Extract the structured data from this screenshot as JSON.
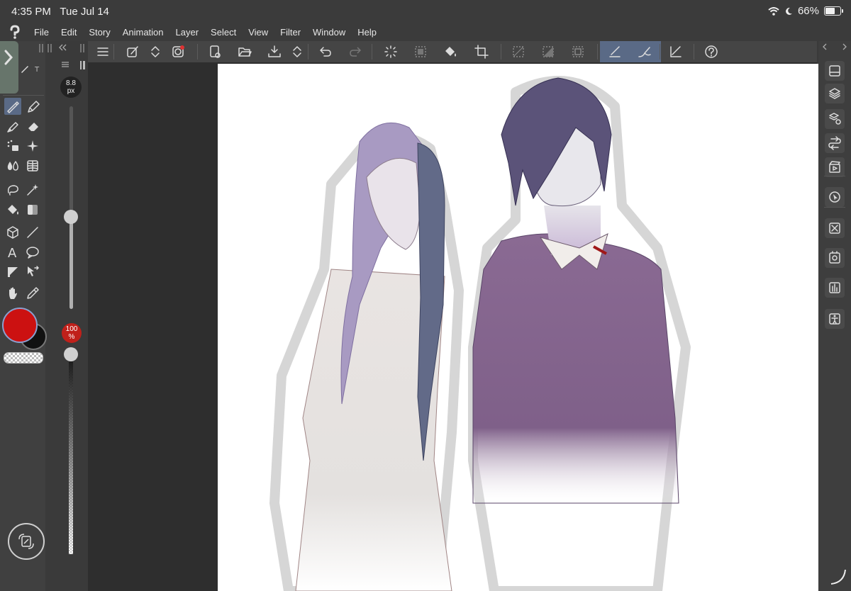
{
  "status": {
    "time": "4:35 PM",
    "date": "Tue Jul 14",
    "battery": "66%"
  },
  "menu": [
    "File",
    "Edit",
    "Story",
    "Animation",
    "Layer",
    "Select",
    "View",
    "Filter",
    "Window",
    "Help"
  ],
  "brush": {
    "size_value": "8.8",
    "size_unit": "px",
    "opacity_value": "100",
    "opacity_unit": "%"
  },
  "colors": {
    "main": "#cc1111",
    "sub": "#111111",
    "accent": "#5a6a86",
    "opacity_badge": "#c0201a"
  },
  "tools": [
    "pen-icon",
    "pencil-icon",
    "marker-icon",
    "eraser-icon",
    "airbrush-icon",
    "decoration-icon",
    "blend-icon",
    "mesh-icon",
    "lasso-icon",
    "magic-wand-icon",
    "fill-icon",
    "gradient-icon",
    "3d-object-icon",
    "line-icon",
    "text-icon",
    "balloon-icon",
    "ruler-icon",
    "operation-icon",
    "hand-icon",
    "eyedropper-icon"
  ],
  "commands": [
    "menu-icon",
    "edit-brush-icon",
    "updown-icon",
    "companion-icon",
    "new-icon",
    "open-icon",
    "save-icon",
    "updown-icon",
    "undo-icon",
    "redo-icon",
    "loading-icon",
    "clear-selection-icon",
    "fill-icon",
    "crop-icon",
    "select-all-icon",
    "invert-icon",
    "border-icon",
    "draw-mode-icon",
    "brush-mode-icon",
    "ruler-mode-icon",
    "help-icon"
  ],
  "right_panels": [
    "window-icon",
    "layers-icon",
    "sub-view-icon",
    "auto-actions-icon",
    "animation-icon",
    "navigator-icon",
    "material-icon",
    "history-icon",
    "tool-property-icon",
    "accessibility-icon"
  ]
}
